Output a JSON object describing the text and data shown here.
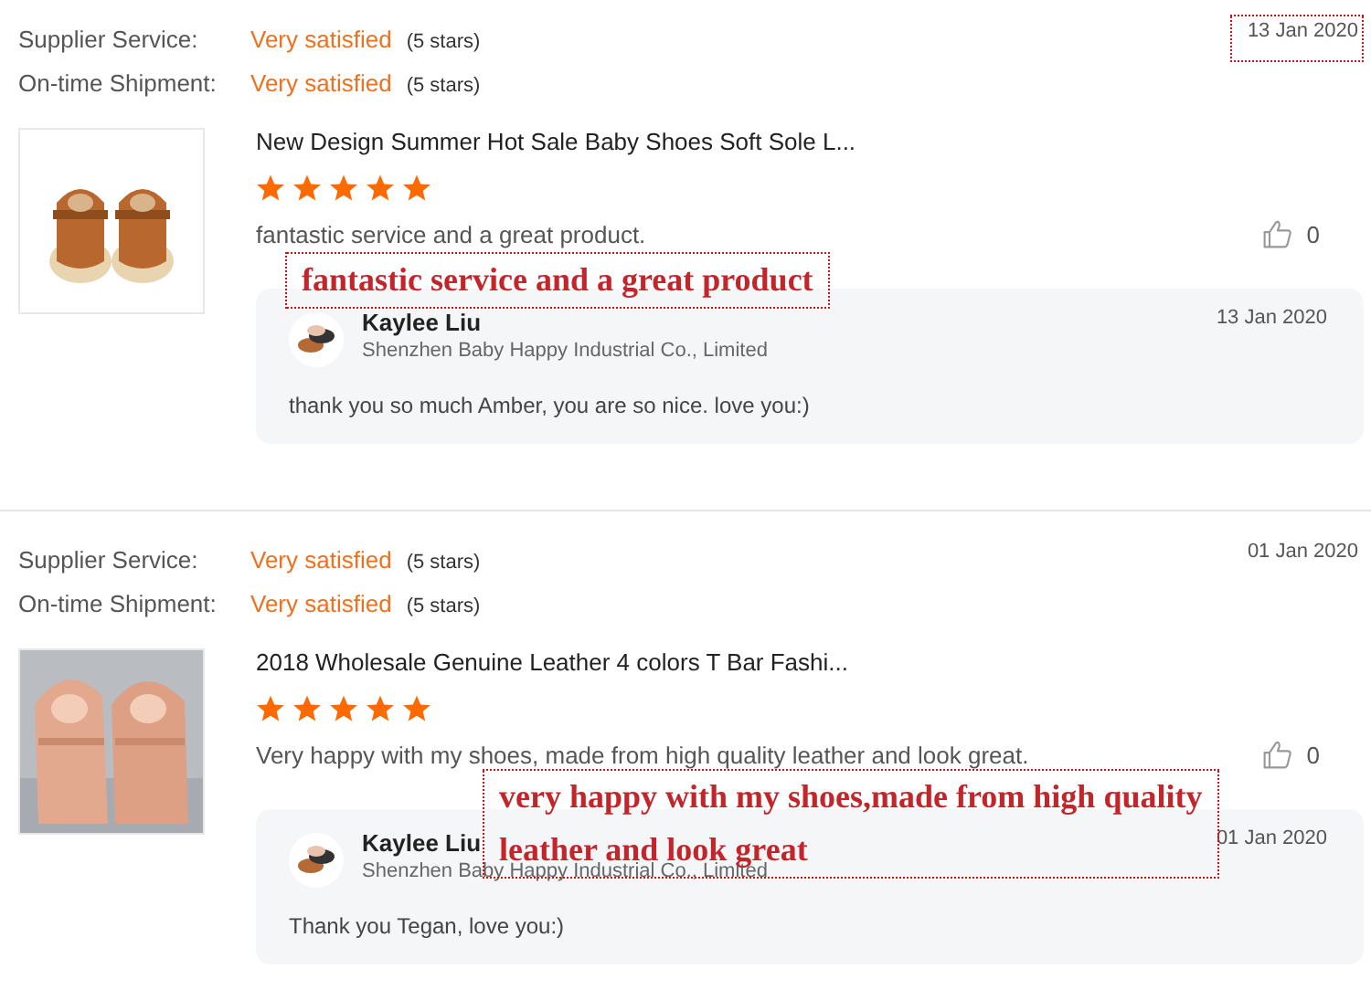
{
  "reviews": [
    {
      "ratings": [
        {
          "label": "Supplier Service:",
          "value": "Very satisfied",
          "detail": "(5 stars)"
        },
        {
          "label": "On-time Shipment:",
          "value": "Very satisfied",
          "detail": "(5 stars)"
        }
      ],
      "date": "13 Jan 2020",
      "date_highlighted": true,
      "product": {
        "title": "New Design Summer Hot Sale Baby Shoes Soft Sole L..."
      },
      "stars": 5,
      "comment": "fantastic service and a great product.",
      "likes": "0",
      "callout": [
        "fantastic service and a great product"
      ],
      "reply": {
        "name": "Kaylee Liu",
        "company": "Shenzhen Baby Happy Industrial Co., Limited",
        "date": "13 Jan 2020",
        "text": "thank you so much Amber, you are so nice. love you:)"
      }
    },
    {
      "ratings": [
        {
          "label": "Supplier Service:",
          "value": "Very satisfied",
          "detail": "(5 stars)"
        },
        {
          "label": "On-time Shipment:",
          "value": "Very satisfied",
          "detail": "(5 stars)"
        }
      ],
      "date": "01 Jan 2020",
      "date_highlighted": false,
      "product": {
        "title": "2018 Wholesale Genuine Leather 4 colors T Bar Fashi..."
      },
      "stars": 5,
      "comment": "Very happy with my shoes, made from high quality leather and look great.",
      "likes": "0",
      "callout": [
        "very happy with my shoes,made from high quality",
        "leather and look great"
      ],
      "reply": {
        "name": "Kaylee Liu",
        "company": "Shenzhen Baby Happy Industrial Co., Limited",
        "date": "01 Jan 2020",
        "text": "Thank you Tegan, love you:)"
      }
    }
  ]
}
